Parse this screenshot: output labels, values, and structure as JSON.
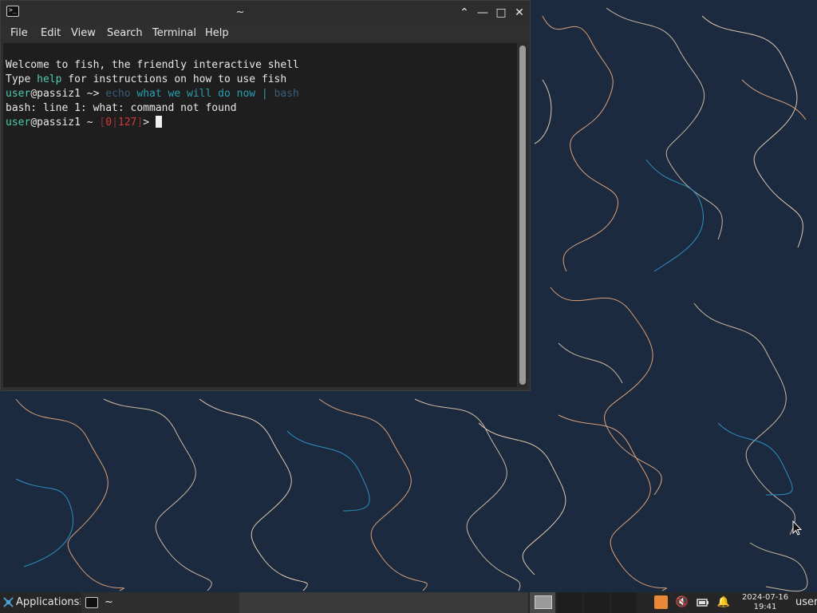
{
  "window": {
    "title": "~",
    "menu": [
      "File",
      "Edit",
      "View",
      "Search",
      "Terminal",
      "Help"
    ]
  },
  "terminal": {
    "welcome": "Welcome to fish, the friendly interactive shell",
    "type_prefix": "Type ",
    "type_help": "help",
    "type_suffix": " for instructions on how to use fish",
    "user": "user",
    "host": "@passiz1",
    "prompt1_sep": " ~> ",
    "cmd_echo": "echo",
    "cmd_args": " what we will do now | ",
    "cmd_bash": "bash",
    "error": "bash: line 1: what: command not found",
    "prompt2_tilde": " ~ ",
    "status_open": "[",
    "status_a": "0",
    "status_pipe": "|",
    "status_b": "127",
    "status_close": "]",
    "prompt2_arrow": "> "
  },
  "taskbar": {
    "applications": "Applications",
    "task_label": "~",
    "clock_date": "2024-07-16",
    "clock_time": "19:41",
    "user": "user"
  },
  "icons": {
    "window_controls": [
      "chevron-up-icon",
      "minimize-icon",
      "maximize-icon",
      "close-icon"
    ],
    "tray": [
      "updates-icon",
      "mute-icon",
      "battery-icon",
      "bell-icon"
    ]
  },
  "colors": {
    "wallpaper": "#1b2a3e",
    "terminal_bg": "#1e1e1e",
    "prompt_green": "#4ec9b0",
    "command_cyan": "#2a9fb1",
    "error_red": "#d23b3b"
  }
}
